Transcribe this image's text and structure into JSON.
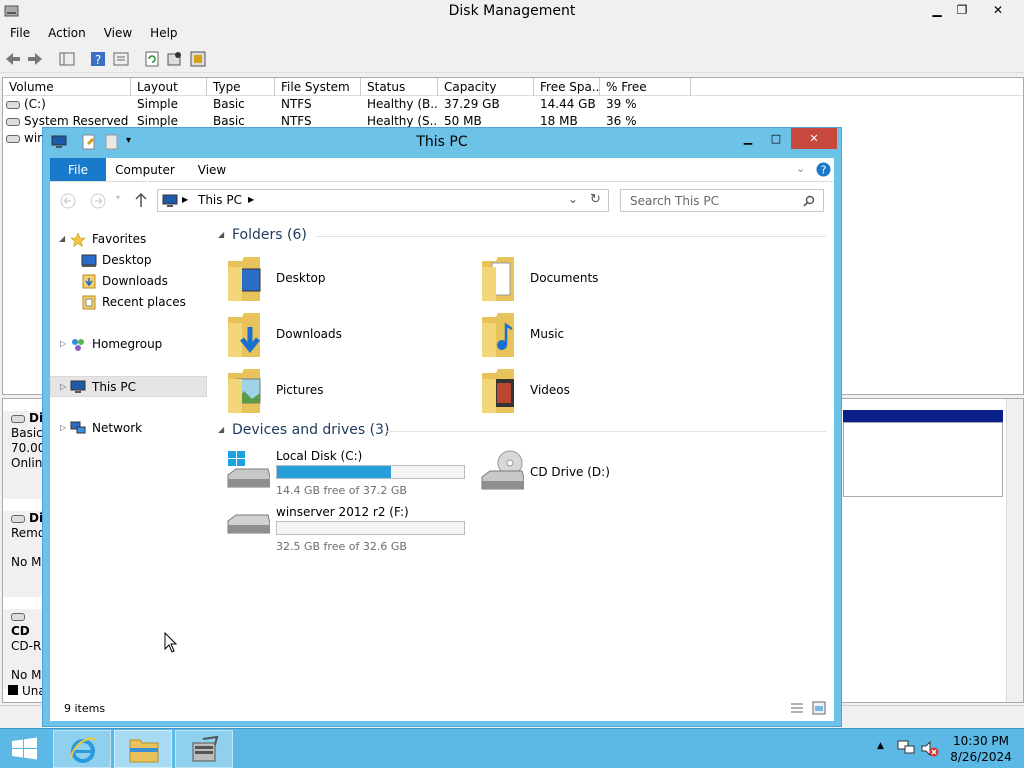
{
  "disk_mgmt": {
    "title": "Disk Management",
    "menu": [
      "File",
      "Action",
      "View",
      "Help"
    ],
    "columns": [
      "Volume",
      "Layout",
      "Type",
      "File System",
      "Status",
      "Capacity",
      "Free Spa...",
      "% Free"
    ],
    "rows": [
      [
        "(C:)",
        "Simple",
        "Basic",
        "NTFS",
        "Healthy (B...",
        "37.29 GB",
        "14.44 GB",
        "39 %"
      ],
      [
        "System Reserved",
        "Simple",
        "Basic",
        "NTFS",
        "Healthy (S...",
        "50 MB",
        "18 MB",
        "36 %"
      ],
      [
        "win",
        "",
        "",
        "",
        "",
        "",
        "",
        ""
      ]
    ],
    "disk_panel": {
      "disk0": {
        "name": "Di",
        "lines": [
          "Basic",
          "70.00",
          "Onlin"
        ]
      },
      "disk1": {
        "name": "Di",
        "lines": [
          "Remo",
          "",
          "No M"
        ]
      },
      "cd": {
        "name": "CD",
        "lines": [
          "CD-R",
          "",
          "No M"
        ]
      },
      "legend": "Una"
    },
    "controls": {
      "minimize": "▁",
      "restore": "❐",
      "close": "✕"
    }
  },
  "explorer": {
    "title": "This PC",
    "ribbon_tabs": [
      "File",
      "Computer",
      "View"
    ],
    "address": {
      "location": "This PC"
    },
    "search_placeholder": "Search This PC",
    "nav": {
      "favorites": "Favorites",
      "desktop": "Desktop",
      "downloads": "Downloads",
      "recent": "Recent places",
      "homegroup": "Homegroup",
      "this_pc": "This PC",
      "network": "Network"
    },
    "folders_header": "Folders (6)",
    "folders": [
      "Desktop",
      "Documents",
      "Downloads",
      "Music",
      "Pictures",
      "Videos"
    ],
    "devices_header": "Devices and drives (3)",
    "drives": [
      {
        "name": "Local Disk (C:)",
        "free_text": "14.4 GB free of 37.2 GB",
        "used_fraction": 0.61
      },
      {
        "name": "CD Drive (D:)"
      },
      {
        "name": "winserver 2012 r2 (F:)",
        "free_text": "32.5 GB free of 32.6 GB",
        "used_fraction": 0.0
      }
    ],
    "status": "9 items",
    "controls": {
      "minimize": "▁",
      "maximize": "□",
      "close": "✕"
    }
  },
  "taskbar": {
    "time": "10:30 PM",
    "date": "8/26/2024"
  },
  "colors": {
    "explorer_frame": "#6dc2e8",
    "ribbon_file": "#1979ca",
    "progress_fill": "#26a0da",
    "taskbar": "#5cb8e4",
    "close_button": "#c7483d"
  }
}
